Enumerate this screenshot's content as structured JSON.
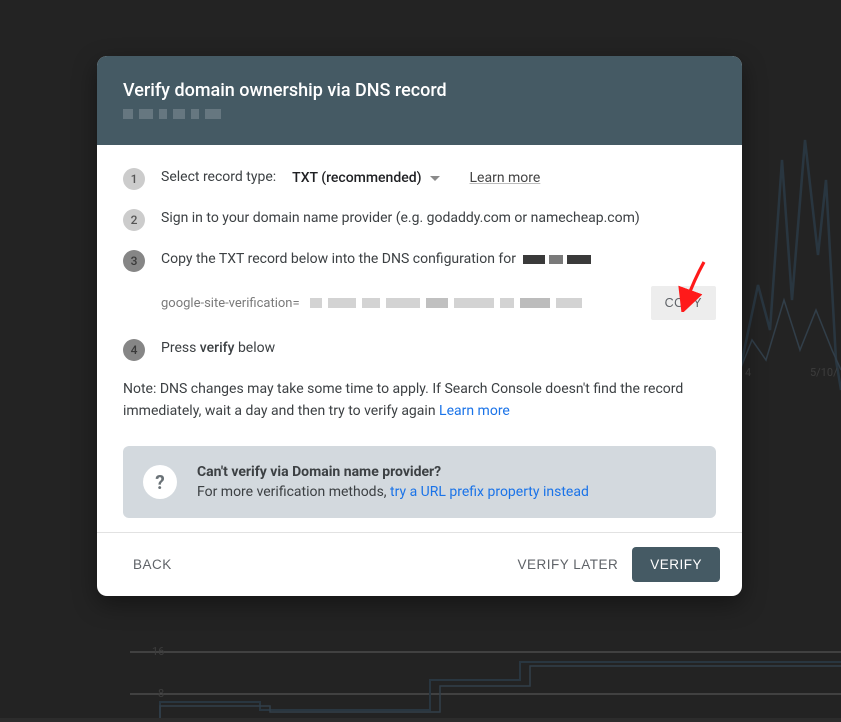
{
  "modal": {
    "title": "Verify domain ownership via DNS record",
    "step1": {
      "num": "1",
      "label": "Select record type:",
      "dropdown": "TXT (recommended)",
      "learn_more": "Learn more"
    },
    "step2": {
      "num": "2",
      "text": "Sign in to your domain name provider (e.g. godaddy.com or namecheap.com)"
    },
    "step3": {
      "num": "3",
      "text": "Copy the TXT record below into the DNS configuration for"
    },
    "txt": {
      "prefix": "google-site-verification=",
      "copy": "COPY"
    },
    "step4": {
      "num": "4",
      "text_a": "Press ",
      "bold": "verify",
      "text_b": " below"
    },
    "note_a": "Note: DNS changes may take some time to apply. If Search Console doesn't find the record immediately, wait a day and then try to verify again ",
    "note_link": "Learn more",
    "tip": {
      "title": "Can't verify via Domain name provider?",
      "text": "For more verification methods, ",
      "link": "try a URL prefix property instead"
    },
    "footer": {
      "back": "BACK",
      "later": "VERIFY LATER",
      "verify": "VERIFY"
    }
  },
  "bg": {
    "y16": "16",
    "y8": "8",
    "x1": "4",
    "x2": "5/10/"
  }
}
